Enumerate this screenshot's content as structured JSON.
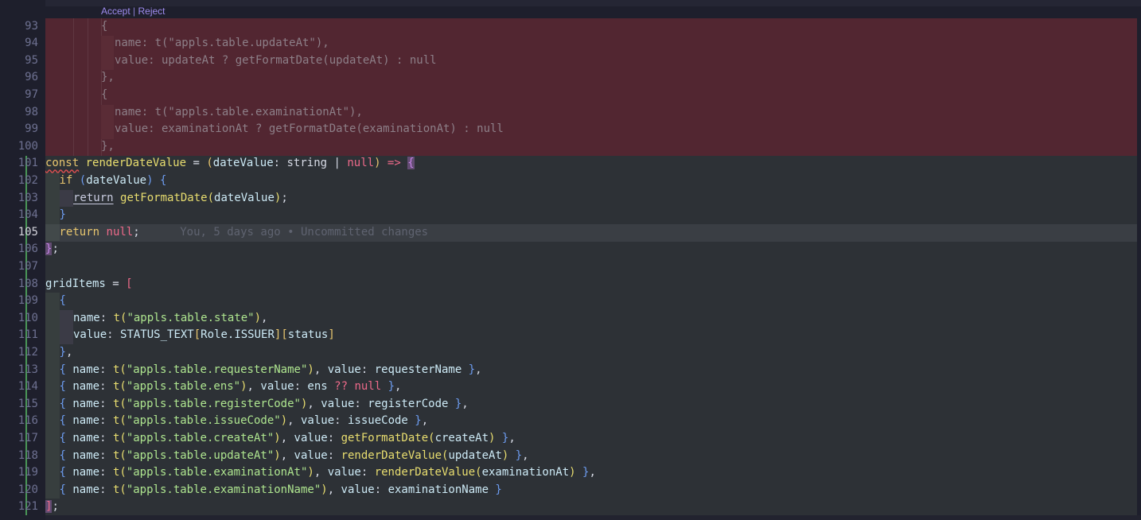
{
  "codelens": {
    "accept": "Accept",
    "separator": "|",
    "reject": "Reject"
  },
  "blame": {
    "line": 105,
    "text": "You, 5 days ago • Uncommitted changes"
  },
  "line_numbers": [
    "93",
    "94",
    "95",
    "96",
    "97",
    "98",
    "99",
    "100",
    "101",
    "102",
    "103",
    "104",
    "105",
    "106",
    "107",
    "108",
    "109",
    "110",
    "111",
    "112",
    "113",
    "114",
    "115",
    "116",
    "117",
    "118",
    "119",
    "120",
    "121"
  ],
  "current_line": "105",
  "removed_lines": [
    "{",
    "name: t(\"appls.table.updateAt\"),",
    "value: updateAt ? getFormatDate(updateAt) : null",
    "},",
    "{",
    "name: t(\"appls.table.examinationAt\"),",
    "value: examinationAt ? getFormatDate(examinationAt) : null",
    "},"
  ],
  "code": {
    "l101": {
      "const": "const",
      "fnname": "renderDateValue",
      "eq": " = ",
      "p1": "(",
      "param": "dateValue",
      "colon": ": ",
      "type": "string | ",
      "null": "null",
      "p2": ")",
      "arrow": " => ",
      "brace": "{"
    },
    "l102": {
      "if": "if",
      "sp": " ",
      "p1": "(",
      "cond": "dateValue",
      "p2": ")",
      "brace": " {"
    },
    "l103": {
      "ret": "return",
      "fn": "getFormatDate",
      "p1": "(",
      "arg": "dateValue",
      "p2": ")",
      "semi": ";"
    },
    "l104": {
      "brace": "}"
    },
    "l105": {
      "ret": "return",
      "null": "null",
      "semi": ";"
    },
    "l106": {
      "brace": "}",
      "semi": ";"
    },
    "l108": {
      "name": "gridItems",
      "eq": " = ",
      "brk": "["
    },
    "l109": {
      "brace": "{"
    },
    "l110": {
      "key": "name",
      "colon": ": ",
      "fn": "t",
      "p1": "(",
      "str": "\"appls.table.state\"",
      "p2": ")",
      "comma": ","
    },
    "l111": {
      "key": "value",
      "colon": ": ",
      "obj": "STATUS_TEXT",
      "b1": "[",
      "idx": "Role.ISSUER",
      "b2": "]",
      "b3": "[",
      "idx2": "status",
      "b4": "]"
    },
    "l112": {
      "brace": "}",
      "comma": ","
    },
    "items": [
      {
        "open": "{ ",
        "nk": "name",
        "c1": ": ",
        "fn": "t",
        "p1": "(",
        "str": "\"appls.table.requesterName\"",
        "p2": ")",
        "mid": ", ",
        "vk": "value",
        "c2": ": ",
        "val": "requesterName",
        "close": " }",
        "tail": ","
      },
      {
        "open": "{ ",
        "nk": "name",
        "c1": ": ",
        "fn": "t",
        "p1": "(",
        "str": "\"appls.table.ens\"",
        "p2": ")",
        "mid": ", ",
        "vk": "value",
        "c2": ": ",
        "val": "ens",
        "op": " ?? ",
        "nul": "null",
        "close": " }",
        "tail": ","
      },
      {
        "open": "{ ",
        "nk": "name",
        "c1": ": ",
        "fn": "t",
        "p1": "(",
        "str": "\"appls.table.registerCode\"",
        "p2": ")",
        "mid": ", ",
        "vk": "value",
        "c2": ": ",
        "val": "registerCode",
        "close": " }",
        "tail": ","
      },
      {
        "open": "{ ",
        "nk": "name",
        "c1": ": ",
        "fn": "t",
        "p1": "(",
        "str": "\"appls.table.issueCode\"",
        "p2": ")",
        "mid": ", ",
        "vk": "value",
        "c2": ": ",
        "val": "issueCode",
        "close": " }",
        "tail": ","
      },
      {
        "open": "{ ",
        "nk": "name",
        "c1": ": ",
        "fn": "t",
        "p1": "(",
        "str": "\"appls.table.createAt\"",
        "p2": ")",
        "mid": ", ",
        "vk": "value",
        "c2": ": ",
        "vfn": "getFormatDate",
        "vp1": "(",
        "varg": "createAt",
        "vp2": ")",
        "close": " }",
        "tail": ","
      },
      {
        "open": "{ ",
        "nk": "name",
        "c1": ": ",
        "fn": "t",
        "p1": "(",
        "str": "\"appls.table.updateAt\"",
        "p2": ")",
        "mid": ", ",
        "vk": "value",
        "c2": ": ",
        "vfn": "renderDateValue",
        "vp1": "(",
        "varg": "updateAt",
        "vp2": ")",
        "close": " }",
        "tail": ","
      },
      {
        "open": "{ ",
        "nk": "name",
        "c1": ": ",
        "fn": "t",
        "p1": "(",
        "str": "\"appls.table.examinationAt\"",
        "p2": ")",
        "mid": ", ",
        "vk": "value",
        "c2": ": ",
        "vfn": "renderDateValue",
        "vp1": "(",
        "varg": "examinationAt",
        "vp2": ")",
        "close": " }",
        "tail": ","
      },
      {
        "open": "{ ",
        "nk": "name",
        "c1": ": ",
        "fn": "t",
        "p1": "(",
        "str": "\"appls.table.examinationName\"",
        "p2": ")",
        "mid": ", ",
        "vk": "value",
        "c2": ": ",
        "val": "examinationName",
        "close": " }",
        "tail": ""
      }
    ],
    "l121": {
      "brk": "]",
      "semi": ";"
    }
  },
  "colors": {
    "background": "#1e1f2c",
    "removed_bg": "#522631",
    "added_bg": "#2d3136",
    "added_bar": "#4a9657",
    "keyword": "#e8c66e",
    "function": "#e8dd6f",
    "string": "#aee58f",
    "null": "#ee6a8a",
    "codelens": "#9f8cf0"
  }
}
